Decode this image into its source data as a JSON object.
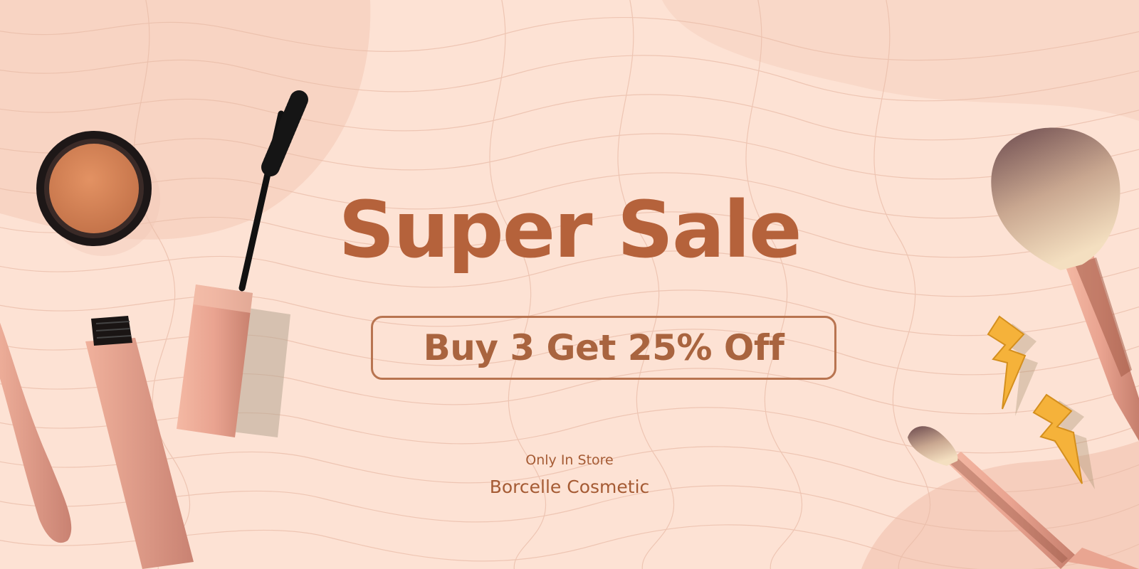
{
  "promo": {
    "title": "Super Sale",
    "offer": "Buy 3 Get 25% Off",
    "note": "Only In Store",
    "brand": "Borcelle Cosmetic"
  },
  "colors": {
    "background": "#fde2d4",
    "accent": "#b5623b",
    "rose_gold": "#e7a793"
  },
  "decorations": [
    "blush-compact-icon",
    "mascara-icon",
    "lip-tube-icon",
    "powder-brush-icon",
    "makeup-brush-icon",
    "lightning-earring-icon"
  ]
}
